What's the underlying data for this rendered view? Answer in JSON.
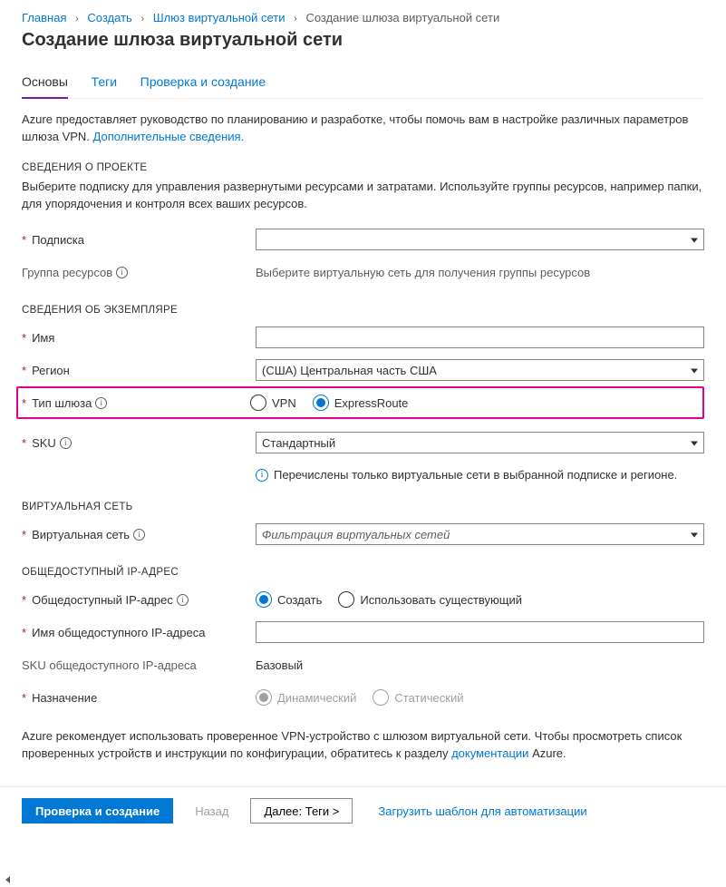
{
  "breadcrumb": {
    "items": [
      "Главная",
      "Создать",
      "Шлюз виртуальной сети",
      "Создание шлюза виртуальной сети"
    ]
  },
  "title": "Создание шлюза виртуальной сети",
  "tabs": {
    "basics": "Основы",
    "tags": "Теги",
    "review": "Проверка и создание"
  },
  "intro": {
    "text": "Azure предоставляет руководство по планированию и разработке, чтобы помочь вам в настройке различных параметров шлюза VPN. ",
    "link": "Дополнительные сведения."
  },
  "projectSection": {
    "heading": "СВЕДЕНИЯ О ПРОЕКТЕ",
    "desc": "Выберите подписку для управления развернутыми ресурсами и затратами. Используйте группы ресурсов, например папки, для упорядочения и контроля всех ваших ресурсов.",
    "subscription_label": "Подписка",
    "subscription_value": "",
    "rg_label": "Группа ресурсов",
    "rg_placeholder": "Выберите виртуальную сеть для получения группы ресурсов"
  },
  "instanceSection": {
    "heading": "СВЕДЕНИЯ ОБ ЭКЗЕМПЛЯРЕ",
    "name_label": "Имя",
    "name_value": "",
    "region_label": "Регион",
    "region_value": "(США) Центральная часть США",
    "gwtype_label": "Тип шлюза",
    "gwtype_options": {
      "vpn": "VPN",
      "er": "ExpressRoute"
    },
    "gwtype_selected": "er",
    "sku_label": "SKU",
    "sku_value": "Стандартный",
    "sku_hint": "Перечислены только виртуальные сети в выбранной подписке и регионе."
  },
  "vnetSection": {
    "heading": "ВИРТУАЛЬНАЯ СЕТЬ",
    "vnet_label": "Виртуальная сеть",
    "vnet_placeholder": "Фильтрация виртуальных сетей"
  },
  "ipSection": {
    "heading": "ОБЩЕДОСТУПНЫЙ IP-АДРЕС",
    "pip_label": "Общедоступный IP-адрес",
    "pip_options": {
      "create": "Создать",
      "existing": "Использовать существующий"
    },
    "pip_selected": "create",
    "pipname_label": "Имя общедоступного IP-адреса",
    "pipname_value": "",
    "pipsku_label": "SKU общедоступного IP-адреса",
    "pipsku_value": "Базовый",
    "assignment_label": "Назначение",
    "assignment_options": {
      "dynamic": "Динамический",
      "static": "Статический"
    },
    "assignment_selected": "dynamic"
  },
  "footnote": {
    "pre": "Azure рекомендует использовать проверенное VPN-устройство с шлюзом виртуальной сети. Чтобы просмотреть список проверенных устройств и инструкции по конфигурации, обратитесь к разделу ",
    "link": "документации",
    "post": " Azure."
  },
  "footer": {
    "review": "Проверка и создание",
    "back": "Назад",
    "next": "Далее: Теги >",
    "download": "Загрузить шаблон для автоматизации"
  }
}
